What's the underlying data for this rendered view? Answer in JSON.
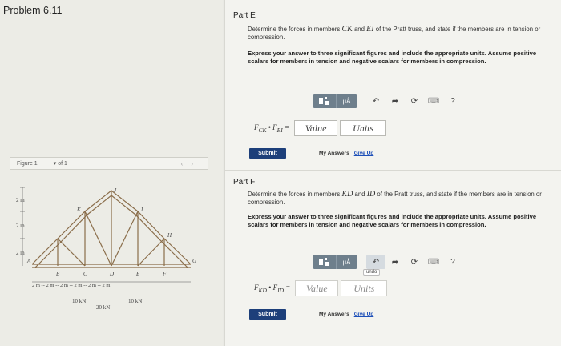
{
  "problem": {
    "title": "Problem 6.11"
  },
  "figure": {
    "label": "Figure 1",
    "page_of": "of 1",
    "prev_icon": "chevron-left-icon",
    "next_icon": "chevron-right-icon",
    "dims": [
      "2 m",
      "2 m",
      "2 m"
    ],
    "nodes": [
      "A",
      "B",
      "C",
      "D",
      "E",
      "F",
      "G",
      "H",
      "I",
      "J",
      "K"
    ],
    "bottom_dims": "2 m -- 2 m -- 2 m -- 2 m -- 2 m -- 2 m",
    "loads": [
      "10 kN",
      "20 kN",
      "10 kN"
    ]
  },
  "partE": {
    "label": "Part E",
    "question_pre": "Determine the forces in members ",
    "q_m1": "CK",
    "q_mid": " and ",
    "q_m2": "EI",
    "question_post": " of the Pratt truss, and state if the members are in tension or compression.",
    "instructions": "Express your answer to three significant figures and include the appropriate units. Assume positive scalars for members in tension and negative scalars for members in compression.",
    "toolbar": {
      "mu": "μÅ",
      "help": "?"
    },
    "equation": "F",
    "eq_sub1": "CK",
    "eq_sep": " • F",
    "eq_sub2": "EI",
    "eq_end": " =",
    "value_placeholder": "Value",
    "units_placeholder": "Units",
    "submit": "Submit",
    "my_answers": "My Answers",
    "give_up": "Give Up"
  },
  "partF": {
    "label": "Part F",
    "question_pre": "Determine the forces in members ",
    "q_m1": "KD",
    "q_mid": " and ",
    "q_m2": "ID",
    "question_post": " of the Pratt truss, and state if the members are in tension or compression.",
    "instructions": "Express your answer to three significant figures and include the appropriate units. Assume positive scalars for members in tension and negative scalars for members in compression.",
    "toolbar": {
      "mu": "μÅ",
      "help": "?",
      "undo_tip": "undo"
    },
    "equation": "F",
    "eq_sub1": "KD",
    "eq_sep": " • F",
    "eq_sub2": "ID",
    "eq_end": " =",
    "value_placeholder": "Value",
    "units_placeholder": "Units",
    "submit": "Submit",
    "my_answers": "My Answers",
    "give_up": "Give Up"
  }
}
